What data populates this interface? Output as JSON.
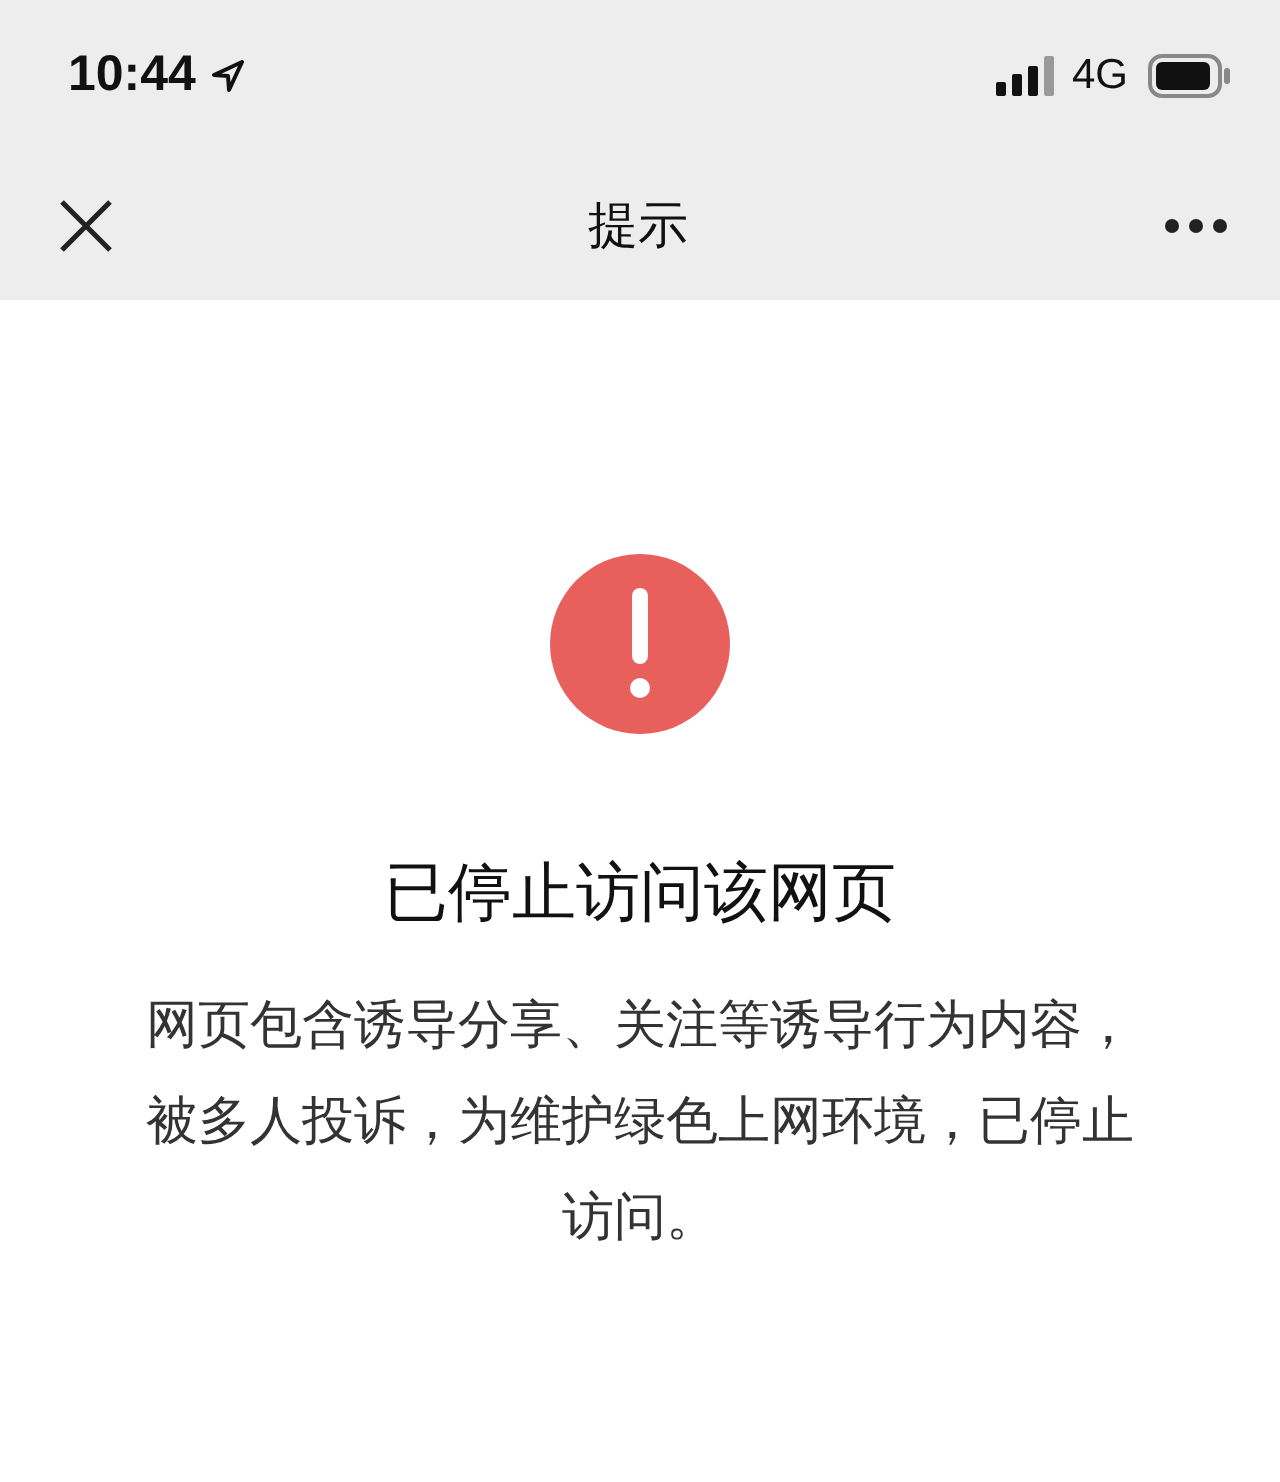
{
  "status_bar": {
    "time": "10:44",
    "network": "4G"
  },
  "nav_bar": {
    "title": "提示"
  },
  "message": {
    "title": "已停止访问该网页",
    "body": "网页包含诱导分享、关注等诱导行为内容，被多人投诉，为维护绿色上网环境，已停止访问。"
  }
}
